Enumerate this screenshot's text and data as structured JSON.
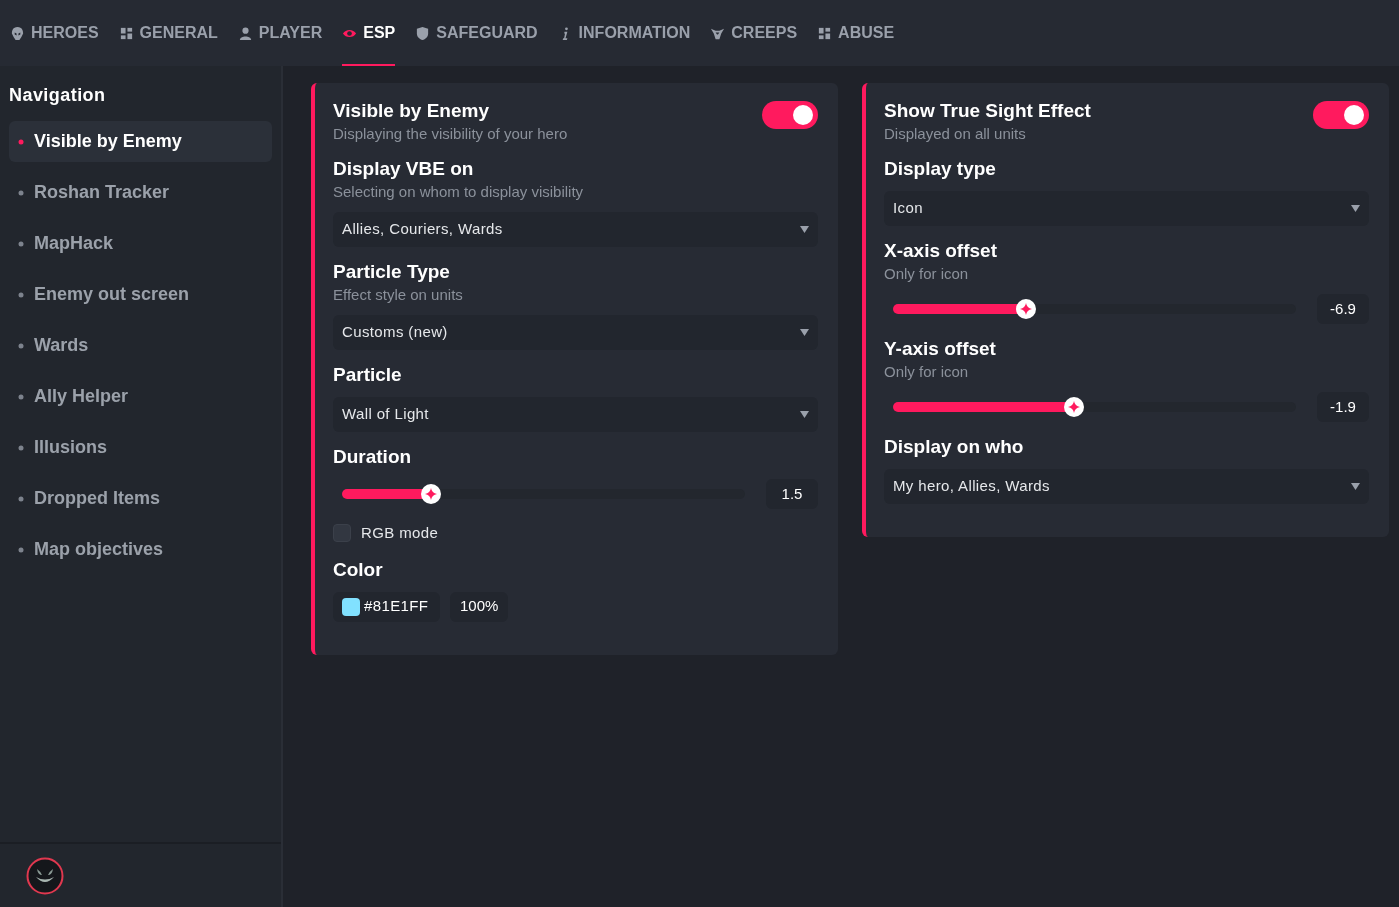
{
  "top_tabs": [
    {
      "label": "HEROES",
      "selected": false
    },
    {
      "label": "GENERAL",
      "selected": false
    },
    {
      "label": "PLAYER",
      "selected": false
    },
    {
      "label": "ESP",
      "selected": true
    },
    {
      "label": "SAFEGUARD",
      "selected": false
    },
    {
      "label": "INFORMATION",
      "selected": false
    },
    {
      "label": "CREEPS",
      "selected": false
    },
    {
      "label": "ABUSE",
      "selected": false
    }
  ],
  "sidebar": {
    "title": "Navigation",
    "items": [
      {
        "label": "Visible by Enemy",
        "selected": true
      },
      {
        "label": "Roshan Tracker",
        "selected": false
      },
      {
        "label": "MapHack",
        "selected": false
      },
      {
        "label": "Enemy out screen",
        "selected": false
      },
      {
        "label": "Wards",
        "selected": false
      },
      {
        "label": "Ally Helper",
        "selected": false
      },
      {
        "label": "Illusions",
        "selected": false
      },
      {
        "label": "Dropped Items",
        "selected": false
      },
      {
        "label": "Map objectives",
        "selected": false
      }
    ]
  },
  "cards": [
    {
      "settings": [
        {
          "kind": "toggle",
          "title": "Visible by Enemy",
          "subtitle": "Displaying the visibility of your hero",
          "on": true
        },
        {
          "kind": "dropdown",
          "title": "Display VBE on",
          "subtitle": "Selecting on whom to display visibility",
          "value": "Allies, Couriers, Wards"
        },
        {
          "kind": "dropdown",
          "title": "Particle Type",
          "subtitle": "Effect style on units",
          "value": "Customs (new)"
        },
        {
          "kind": "dropdown",
          "title": "Particle",
          "value": "Wall of Light"
        },
        {
          "kind": "slider",
          "title": "Duration",
          "level": 0.22,
          "reading": "1.5"
        },
        {
          "kind": "checkbox",
          "label": "RGB mode",
          "checked": false
        },
        {
          "kind": "color",
          "title": "Color",
          "hex": "#81E1FF",
          "color": "#81e1ff",
          "opacity": "100%"
        }
      ]
    },
    {
      "settings": [
        {
          "kind": "toggle",
          "title": "Show True Sight Effect",
          "subtitle": "Displayed on all units",
          "on": true
        },
        {
          "kind": "dropdown",
          "title": "Display type",
          "value": "Icon"
        },
        {
          "kind": "slider",
          "title": "X-axis offset",
          "subtitle": "Only for icon",
          "level": 0.33,
          "reading": "-6.9"
        },
        {
          "kind": "slider",
          "title": "Y-axis offset",
          "subtitle": "Only for icon",
          "level": 0.45,
          "reading": "-1.9"
        },
        {
          "kind": "dropdown",
          "title": "Display on who",
          "value": "My hero, Allies, Wards"
        }
      ]
    }
  ]
}
